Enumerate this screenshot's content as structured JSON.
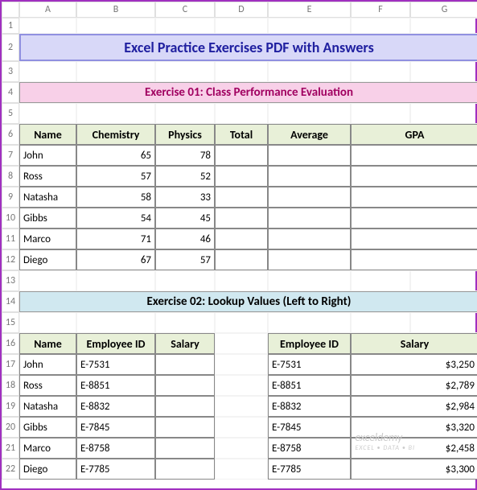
{
  "columns": [
    "",
    "A",
    "B",
    "C",
    "D",
    "E",
    "F",
    "G"
  ],
  "rowcount": 22,
  "main_title": "Excel Practice Exercises PDF with Answers",
  "ex1_title": "Exercise 01: Class Performance Evaluation",
  "ex2_title": "Exercise 02: Lookup Values (Left to Right)",
  "table1": {
    "headers": [
      "Name",
      "Chemistry",
      "Physics",
      "Total",
      "Average",
      "GPA"
    ],
    "rows": [
      {
        "name": "John",
        "chem": "65",
        "phys": "78",
        "total": "",
        "avg": "",
        "gpa": ""
      },
      {
        "name": "Ross",
        "chem": "57",
        "phys": "52",
        "total": "",
        "avg": "",
        "gpa": ""
      },
      {
        "name": "Natasha",
        "chem": "58",
        "phys": "33",
        "total": "",
        "avg": "",
        "gpa": ""
      },
      {
        "name": "Gibbs",
        "chem": "54",
        "phys": "45",
        "total": "",
        "avg": "",
        "gpa": ""
      },
      {
        "name": "Marco",
        "chem": "71",
        "phys": "46",
        "total": "",
        "avg": "",
        "gpa": ""
      },
      {
        "name": "Diego",
        "chem": "67",
        "phys": "57",
        "total": "",
        "avg": "",
        "gpa": ""
      }
    ]
  },
  "table2a": {
    "headers": [
      "Name",
      "Employee ID",
      "Salary"
    ],
    "rows": [
      {
        "name": "John",
        "id": "E-7531",
        "sal": ""
      },
      {
        "name": "Ross",
        "id": "E-8851",
        "sal": ""
      },
      {
        "name": "Natasha",
        "id": "E-8832",
        "sal": ""
      },
      {
        "name": "Gibbs",
        "id": "E-7845",
        "sal": ""
      },
      {
        "name": "Marco",
        "id": "E-8758",
        "sal": ""
      },
      {
        "name": "Diego",
        "id": "E-7785",
        "sal": ""
      }
    ]
  },
  "table2b": {
    "headers": [
      "Employee ID",
      "Salary"
    ],
    "rows": [
      {
        "id": "E-7531",
        "sal": "$3,250"
      },
      {
        "id": "E-8851",
        "sal": "$2,789"
      },
      {
        "id": "E-8832",
        "sal": "$2,984"
      },
      {
        "id": "E-7845",
        "sal": "$3,320"
      },
      {
        "id": "E-8758",
        "sal": "$2,458"
      },
      {
        "id": "E-7785",
        "sal": "$3,300"
      }
    ]
  },
  "watermark": {
    "top": "exceldemy",
    "bottom": "EXCEL • DATA • BI"
  }
}
